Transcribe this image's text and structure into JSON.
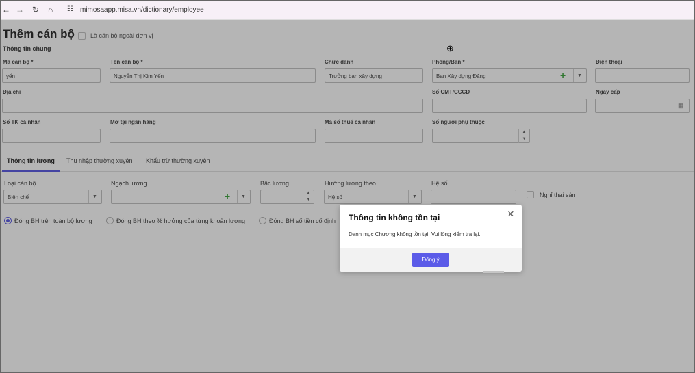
{
  "browser": {
    "back": "←",
    "forward": "→",
    "reload": "↻",
    "home": "⌂",
    "site_info": "☷",
    "url": "mimosaapp.misa.vn/dictionary/employee"
  },
  "page": {
    "title": "Thêm cán bộ",
    "outside_unit_label": "Là cán bộ ngoài đơn vị",
    "section_general": "Thông tin chung",
    "fields": {
      "employee_code": {
        "label": "Mã cán bộ *",
        "value": "yến"
      },
      "employee_name": {
        "label": "Tên cán bộ *",
        "value": "Nguyễn Thị Kim Yến"
      },
      "job_title": {
        "label": "Chức danh",
        "value": "Trưởng ban xây dựng"
      },
      "department": {
        "label": "Phòng/Ban *",
        "value": "Ban Xây dựng Đảng"
      },
      "phone": {
        "label": "Điện thoại",
        "value": ""
      },
      "address": {
        "label": "Địa chỉ",
        "value": ""
      },
      "id_number": {
        "label": "Số CMT/CCCD",
        "value": ""
      },
      "issue_date": {
        "label": "Ngày cấp",
        "value": ""
      },
      "bank_account": {
        "label": "Số TK cá nhân",
        "value": ""
      },
      "bank_name": {
        "label": "Mở tại ngân hàng",
        "value": ""
      },
      "tax_code": {
        "label": "Mã số thuế cá nhân",
        "value": ""
      },
      "dependents": {
        "label": "Số người phụ thuộc",
        "value": ""
      }
    },
    "tabs": [
      "Thông tin lương",
      "Thu nhập thường xuyên",
      "Khấu trừ thường xuyên"
    ],
    "salary": {
      "staff_type": {
        "label": "Loại cán bộ",
        "value": "Biên chế"
      },
      "grade": {
        "label": "Ngạch lương",
        "value": ""
      },
      "level": {
        "label": "Bậc lương",
        "value": ""
      },
      "salary_by": {
        "label": "Hưởng lương theo",
        "value": "Hệ số"
      },
      "coefficient": {
        "label": "Hệ số",
        "value": ""
      },
      "maternity_label": "Nghỉ thai sản",
      "radios": [
        "Đóng BH trên toàn bộ lương",
        "Đóng BH theo % hưởng của từng khoản lương",
        "Đóng BH số tiền cố định"
      ]
    }
  },
  "dialog": {
    "title": "Thông tin không tồn tại",
    "message": "Danh mục Chương không tồn tại. Vui lòng kiểm tra lại.",
    "ok_label": "Đồng ý",
    "close": "×"
  },
  "icons": {
    "plus": "+",
    "caret": "▼",
    "spin_up": "▲",
    "spin_down": "▼",
    "calendar": "▦",
    "zoom": "⊕"
  }
}
